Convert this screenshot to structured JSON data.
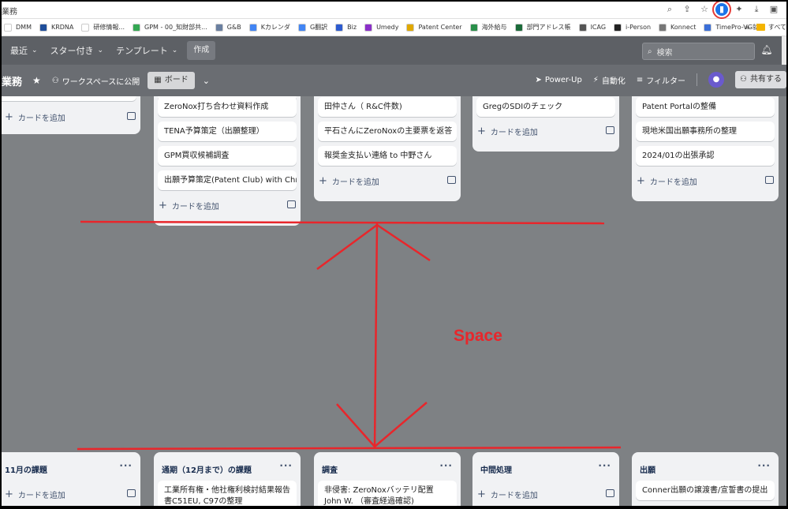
{
  "browser": {
    "tab_title": "業務",
    "bookmarks": [
      {
        "label": "DMM",
        "icon": "bookmark-dmm-icon",
        "color": "#ffffff"
      },
      {
        "label": "KRDNA",
        "icon": "bookmark-krdna-icon",
        "color": "#1f4e9a"
      },
      {
        "label": "研修情報...",
        "icon": "bookmark-training-icon",
        "color": "#ffffff"
      },
      {
        "label": "GPM - 00_知財部共...",
        "icon": "google-drive-icon",
        "color": "#34a853"
      },
      {
        "label": "G&B",
        "icon": "bookmark-gb-icon",
        "color": "#6a7fa0"
      },
      {
        "label": "Kカレンダ",
        "icon": "calendar-icon",
        "color": "#4285f4"
      },
      {
        "label": "G翻訳",
        "icon": "translate-icon",
        "color": "#4285f4"
      },
      {
        "label": "Biz",
        "icon": "bookmark-biz-icon",
        "color": "#2d5bd0"
      },
      {
        "label": "Umedy",
        "icon": "bookmark-umedy-icon",
        "color": "#8b2fc9"
      },
      {
        "label": "Patent Center",
        "icon": "patent-center-icon",
        "color": "#e0a800"
      },
      {
        "label": "海外給与",
        "icon": "bookmark-salary-icon",
        "color": "#2a8f4a"
      },
      {
        "label": "部門アドレス帳",
        "icon": "bookmark-address-icon",
        "color": "#1b6b3a"
      },
      {
        "label": "ICAG",
        "icon": "bookmark-icag-icon",
        "color": "#555555"
      },
      {
        "label": "i-Person",
        "icon": "bookmark-iperson-icon",
        "color": "#222222"
      },
      {
        "label": "Konnect",
        "icon": "bookmark-konnect-icon",
        "color": "#777777"
      },
      {
        "label": "TimePro-VG就業",
        "icon": "bookmark-timepro-icon",
        "color": "#3b6fd8"
      }
    ],
    "more_label": "»",
    "folder_label": "すべて"
  },
  "nav": {
    "items": [
      {
        "label": "最近"
      },
      {
        "label": "スター付き"
      },
      {
        "label": "テンプレート"
      }
    ],
    "create_label": "作成",
    "search_placeholder": "検索"
  },
  "board": {
    "title": "業務",
    "visibility_label": "ワークスペースに公開",
    "view_label": "ボード",
    "powerup_label": "Power-Up",
    "automation_label": "自動化",
    "filter_label": "フィルター",
    "share_label": "共有する"
  },
  "upper_lists": [
    {
      "cards": [],
      "add_label": "カードを追加"
    },
    {
      "cards": [
        "ZeroNox打ち合わせ資料作成",
        "TENA予算策定（出願整理）",
        "GPM買収候補調査",
        "出願予算策定(Patent Club) with Chris"
      ],
      "add_label": "カードを追加"
    },
    {
      "cards": [
        "田仲さん（ R&C件数)",
        "平石さんにZeroNoxの主要票を返答",
        "報奨金支払い連絡 to 中野さん"
      ],
      "add_label": "カードを追加"
    },
    {
      "cards": [
        "GregのSDIのチェック"
      ],
      "add_label": "カードを追加"
    },
    {
      "cards": [
        "Patent Portalの整備",
        "現地米国出願事務所の整理",
        "2024/01の出張承認"
      ],
      "add_label": "カードを追加"
    }
  ],
  "lower_lists": [
    {
      "title": "11月の課題",
      "cards": [],
      "add_label": "カードを追加"
    },
    {
      "title": "通期（12月まで）の課題",
      "cards": [
        "工業所有権・他社権利検討結果報告書C51EU, C97の整理"
      ],
      "add_label": ""
    },
    {
      "title": "調査",
      "cards": [
        "非侵害: ZeroNoxバッテリ配置 John W. （審査経過確認)"
      ],
      "add_label": ""
    },
    {
      "title": "中間処理",
      "cards": [],
      "add_label": "カードを追加"
    },
    {
      "title": "出願",
      "cards": [
        "Conner出願の譲渡書/宣誓書の提出"
      ],
      "add_label": ""
    }
  ],
  "annotation": {
    "label": "Space",
    "color": "#e8262b"
  }
}
